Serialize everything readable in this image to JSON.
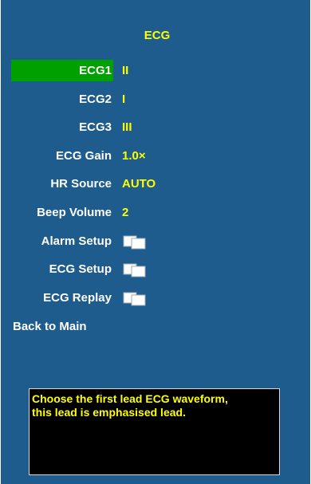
{
  "menu": {
    "title": "ECG",
    "rows": [
      {
        "label": "ECG1",
        "value": "II"
      },
      {
        "label": "ECG2",
        "value": "I"
      },
      {
        "label": "ECG3",
        "value": "III"
      },
      {
        "label": "ECG Gain",
        "value": "1.0×"
      },
      {
        "label": "HR Source",
        "value": "AUTO"
      },
      {
        "label": "Beep Volume",
        "value": "2"
      },
      {
        "label": "Alarm Setup",
        "icon": "submenu-icon"
      },
      {
        "label": "ECG Setup",
        "icon": "submenu-icon"
      },
      {
        "label": "ECG Replay",
        "icon": "submenu-icon"
      },
      {
        "label": "Back to Main"
      }
    ],
    "selected": "ECG1"
  },
  "help": {
    "line1": "Choose the first lead ECG waveform,",
    "line2": "this lead is emphasised lead."
  },
  "colors": {
    "panel": "#1d5c8c",
    "highlight": "#00a000",
    "value_text": "#ffff00",
    "label_text": "#ffffff",
    "help_bg": "#000000"
  }
}
